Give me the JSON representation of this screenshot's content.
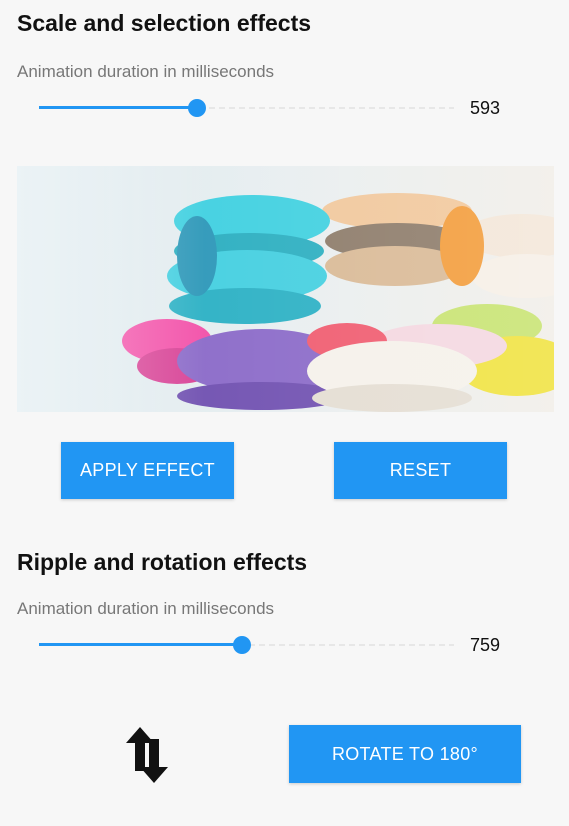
{
  "section1": {
    "title": "Scale and selection effects",
    "slider_label": "Animation duration in milliseconds",
    "slider_value": "593",
    "slider_fraction": 0.38,
    "apply_label": "APPLY EFFECT",
    "reset_label": "RESET"
  },
  "section2": {
    "title": "Ripple and rotation effects",
    "slider_label": "Animation duration in milliseconds",
    "slider_value": "759",
    "slider_fraction": 0.49,
    "rotate_label": "ROTATE TO 180°"
  },
  "colors": {
    "accent": "#2196f3",
    "background": "#f7f7f7"
  }
}
